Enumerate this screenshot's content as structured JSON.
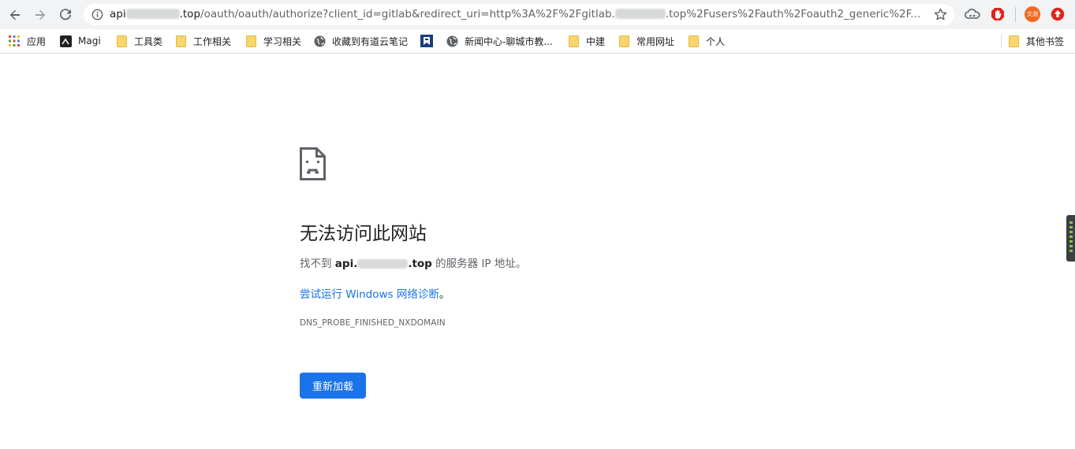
{
  "browser": {
    "url_host_prefix": "api",
    "url_host_suffix": ".top",
    "url_path_a": "/oauth/oauth/authorize?client_id=gitlab&redirect_uri=http%3A%2F%2Fgitlab.",
    "url_path_b": ".top%2Fusers%2Fauth%2Foauth2_generic%2F..."
  },
  "bookmarks": [
    {
      "label": "应用",
      "icon": "apps-grid-icon"
    },
    {
      "label": "Magi",
      "icon": "magi-logo-icon"
    },
    {
      "label": "工具类",
      "icon": "folder-icon"
    },
    {
      "label": "工作相关",
      "icon": "folder-icon"
    },
    {
      "label": "学习相关",
      "icon": "folder-icon"
    },
    {
      "label": "收藏到有道云笔记",
      "icon": "globe-icon"
    },
    {
      "label": "",
      "icon": "bookmark-page-icon"
    },
    {
      "label": "新闻中心-聊城市教...",
      "icon": "globe-icon"
    },
    {
      "label": "中建",
      "icon": "folder-icon"
    },
    {
      "label": "常用网址",
      "icon": "folder-icon"
    },
    {
      "label": "个人",
      "icon": "folder-icon"
    },
    {
      "label": "其他书签",
      "icon": "folder-icon"
    }
  ],
  "error": {
    "title": "无法访问此网站",
    "msg_prefix": "找不到 ",
    "host_prefix": "api.",
    "host_suffix": ".top",
    "msg_suffix": " 的服务器 IP 地址。",
    "suggestion_link": "尝试运行 Windows 网络诊断",
    "suggestion_tail": "。",
    "code": "DNS_PROBE_FINISHED_NXDOMAIN",
    "reload_label": "重新加载"
  },
  "extensions": [
    {
      "name": "cloud-extension-icon"
    },
    {
      "name": "adblock-icon",
      "color": "#e0241c"
    },
    {
      "name": "wenjing-avatar-icon",
      "label": "文测",
      "color": "#f06a24"
    },
    {
      "name": "upload-extension-icon",
      "color": "#e0241c"
    }
  ],
  "colors": {
    "accent": "#1a73e8",
    "toolbar_bg": "#f1f3f4"
  }
}
